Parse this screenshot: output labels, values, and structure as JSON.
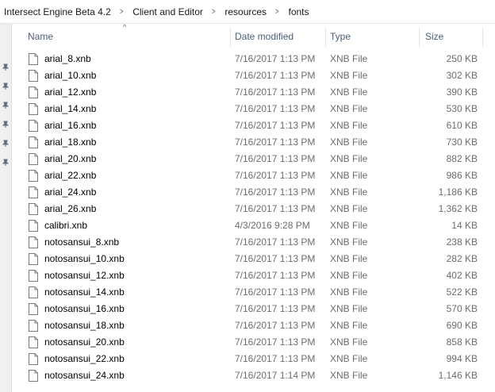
{
  "breadcrumb": [
    "Intersect Engine Beta 4.2",
    "Client and Editor",
    "resources",
    "fonts"
  ],
  "columns": {
    "name": "Name",
    "date": "Date modified",
    "type": "Type",
    "size": "Size"
  },
  "files": [
    {
      "name": "arial_8.xnb",
      "date": "7/16/2017 1:13 PM",
      "type": "XNB File",
      "size": "250 KB"
    },
    {
      "name": "arial_10.xnb",
      "date": "7/16/2017 1:13 PM",
      "type": "XNB File",
      "size": "302 KB"
    },
    {
      "name": "arial_12.xnb",
      "date": "7/16/2017 1:13 PM",
      "type": "XNB File",
      "size": "390 KB"
    },
    {
      "name": "arial_14.xnb",
      "date": "7/16/2017 1:13 PM",
      "type": "XNB File",
      "size": "530 KB"
    },
    {
      "name": "arial_16.xnb",
      "date": "7/16/2017 1:13 PM",
      "type": "XNB File",
      "size": "610 KB"
    },
    {
      "name": "arial_18.xnb",
      "date": "7/16/2017 1:13 PM",
      "type": "XNB File",
      "size": "730 KB"
    },
    {
      "name": "arial_20.xnb",
      "date": "7/16/2017 1:13 PM",
      "type": "XNB File",
      "size": "882 KB"
    },
    {
      "name": "arial_22.xnb",
      "date": "7/16/2017 1:13 PM",
      "type": "XNB File",
      "size": "986 KB"
    },
    {
      "name": "arial_24.xnb",
      "date": "7/16/2017 1:13 PM",
      "type": "XNB File",
      "size": "1,186 KB"
    },
    {
      "name": "arial_26.xnb",
      "date": "7/16/2017 1:13 PM",
      "type": "XNB File",
      "size": "1,362 KB"
    },
    {
      "name": "calibri.xnb",
      "date": "4/3/2016 9:28 PM",
      "type": "XNB File",
      "size": "14 KB"
    },
    {
      "name": "notosansui_8.xnb",
      "date": "7/16/2017 1:13 PM",
      "type": "XNB File",
      "size": "238 KB"
    },
    {
      "name": "notosansui_10.xnb",
      "date": "7/16/2017 1:13 PM",
      "type": "XNB File",
      "size": "282 KB"
    },
    {
      "name": "notosansui_12.xnb",
      "date": "7/16/2017 1:13 PM",
      "type": "XNB File",
      "size": "402 KB"
    },
    {
      "name": "notosansui_14.xnb",
      "date": "7/16/2017 1:13 PM",
      "type": "XNB File",
      "size": "522 KB"
    },
    {
      "name": "notosansui_16.xnb",
      "date": "7/16/2017 1:13 PM",
      "type": "XNB File",
      "size": "570 KB"
    },
    {
      "name": "notosansui_18.xnb",
      "date": "7/16/2017 1:13 PM",
      "type": "XNB File",
      "size": "690 KB"
    },
    {
      "name": "notosansui_20.xnb",
      "date": "7/16/2017 1:13 PM",
      "type": "XNB File",
      "size": "858 KB"
    },
    {
      "name": "notosansui_22.xnb",
      "date": "7/16/2017 1:13 PM",
      "type": "XNB File",
      "size": "994 KB"
    },
    {
      "name": "notosansui_24.xnb",
      "date": "7/16/2017 1:14 PM",
      "type": "XNB File",
      "size": "1,146 KB"
    }
  ],
  "icons": {
    "file": "file-icon",
    "pin": "pin-icon",
    "sort": "sort-ascending-icon"
  }
}
